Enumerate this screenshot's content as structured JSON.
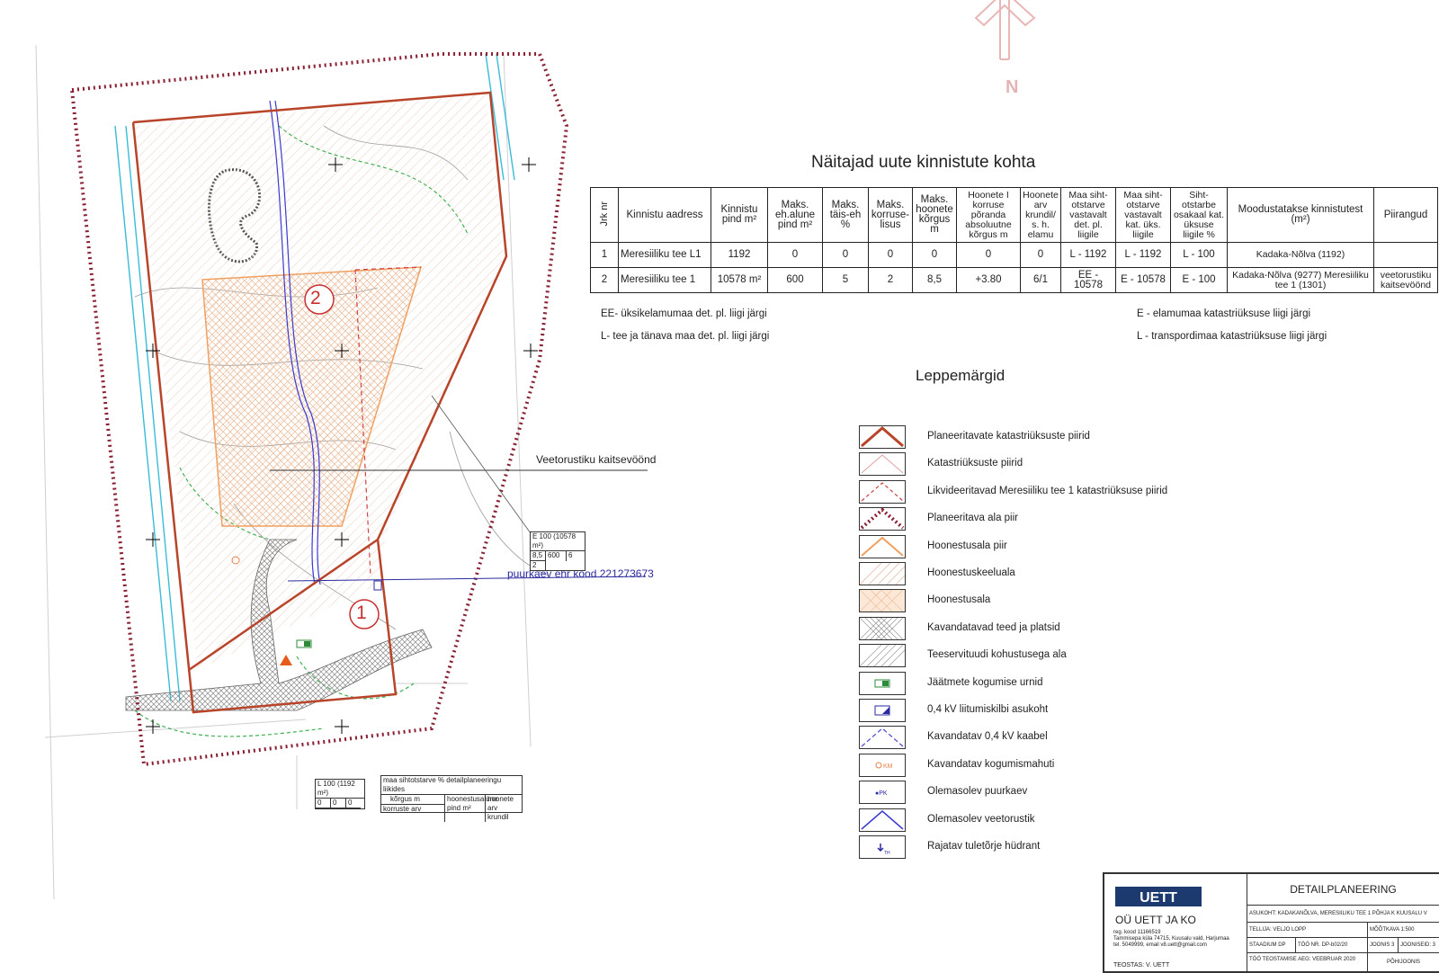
{
  "north_label": "N",
  "lots": {
    "lot1": "1",
    "lot2": "2"
  },
  "callouts": {
    "veetorustik": "Veetorustiku kaitsevöönd",
    "puurkaev": "puurkaev ehr kood 221273673"
  },
  "lot_box_2": {
    "line1": "E 100  (10578 m²)",
    "a": "8,5",
    "b": "600",
    "c": "6",
    "d": "2"
  },
  "lot_box_1": {
    "line1": "L 100   (1192 m²)",
    "a": "0",
    "b": "0",
    "c": "0"
  },
  "key_box": {
    "title": "maa sihtotstarve % detailplaneeringu liikides",
    "r1": "kõrgus m",
    "r2": "korruste arv",
    "c1": "hoonestusalune pind m²",
    "c2": "hoonete arv krundil"
  },
  "table": {
    "title": "Näitajad uute kinnistute kohta",
    "headers": [
      "Jrk nr",
      "Kinnistu aadress",
      "Kinnistu pind m²",
      "Maks. eh.alune pind m²",
      "Maks. täis-eh %",
      "Maks. korruse-lisus",
      "Maks. hoonete kõrgus m",
      "Hoonete I korruse põranda absoluutne kõrgus m",
      "Hoonete arv krundil/ s. h. elamu",
      "Maa siht-otstarve vastavalt det. pl. liigile",
      "Maa siht-otstarve vastavalt kat. üks. liigile",
      "Siht-otstarbe osakaal kat. üksuse liigile %",
      "Moodustatakse kinnistutest (m²)",
      "Piirangud"
    ],
    "rows": [
      [
        "1",
        "Meresiiliku tee L1",
        "1192",
        "0",
        "0",
        "0",
        "0",
        "0",
        "0",
        "L - 1192",
        "L - 1192",
        "L - 100",
        "Kadaka-Nõlva (1192)",
        ""
      ],
      [
        "2",
        "Meresiiliku tee 1",
        "10578 m²",
        "600",
        "5",
        "2",
        "8,5",
        "+3.80",
        "6/1",
        "EE - 10578",
        "E - 10578",
        "E - 100",
        "Kadaka-Nõlva    (9277) Meresiiliku tee 1 (1301)",
        "veetorustiku kaitsevöönd"
      ]
    ]
  },
  "notes": {
    "ee": "EE- üksikelamumaa det. pl. liigi järgi",
    "l": "L- tee ja tänava maa det. pl. liigi järgi",
    "e": "E - elamumaa katastriüksuse liigi järgi",
    "lt": "L - transpordimaa katastriüksuse liigi järgi"
  },
  "legend": {
    "title": "Leppemärgid",
    "items": [
      {
        "label": "Planeeritavate katastriüksuste piirid",
        "icon": "red-thick-lines"
      },
      {
        "label": "Katastriüksuste piirid",
        "icon": "thin-lines"
      },
      {
        "label": "Likvideeritavad Meresiiliku tee 1 katastriüksuse piirid",
        "icon": "dashed-lines"
      },
      {
        "label": "Planeeritava ala piir",
        "icon": "dotted-boundary"
      },
      {
        "label": "Hoonestusala piir",
        "icon": "orange-lines"
      },
      {
        "label": "Hoonestuskeelualа",
        "icon": "hatch"
      },
      {
        "label": "Hoonestusala",
        "icon": "cross-hatch-orange"
      },
      {
        "label": "Kavandatavad teed ja platsid",
        "icon": "grey-crosshatch"
      },
      {
        "label": "Teeservituudi kohustusega ala",
        "icon": "grey-hatch"
      },
      {
        "label": "Jäätmete kogumise urnid",
        "icon": "green-bin"
      },
      {
        "label": "0,4 kV liitumiskilbi asukoht",
        "icon": "blue-box"
      },
      {
        "label": "Kavandatav 0,4 kV kaabel",
        "icon": "blue-lines"
      },
      {
        "label": "Kavandatav kogumismahuti",
        "icon": "km-circle"
      },
      {
        "label": "Olemasolev puurkaev",
        "icon": "pk"
      },
      {
        "label": "Olemasolev veetorustik",
        "icon": "dark-blue-lines"
      },
      {
        "label": "Rajatav tuletõrje hüdrant",
        "icon": "hydrant"
      }
    ]
  },
  "stamp": {
    "company": "OÜ UETT JA KO",
    "title": "DETAILPLANEERING",
    "asukoht": "ASUKOHT:  KADAKANÕLVA, MERESIILIKU TEE 1 PÕHJA K KUUSALU V",
    "tellija": "TELLIJA:  VELJO LOPP",
    "moot": "MÕÕTKAVA      1:500",
    "staadium": "STAADIUM   DP",
    "too": "TÖÖ NR.  DP-b02/20",
    "joonis": "JOONIS  3",
    "joonised": "JOONISEID:  3",
    "aeg": "TÖÖ TEOSTAMISE AEG:  VEEBRUAR 2020",
    "pohijoonis": "PÕHIJOONIS",
    "teostas": "TEOSTAS:  V. UETT",
    "reg": "reg. kood 11166519",
    "addr": "Tammisepa küla 74715, Kuusalu vald, Harjumaa",
    "tel": "tel. 5049999, email v8.uett@gmail.com"
  }
}
